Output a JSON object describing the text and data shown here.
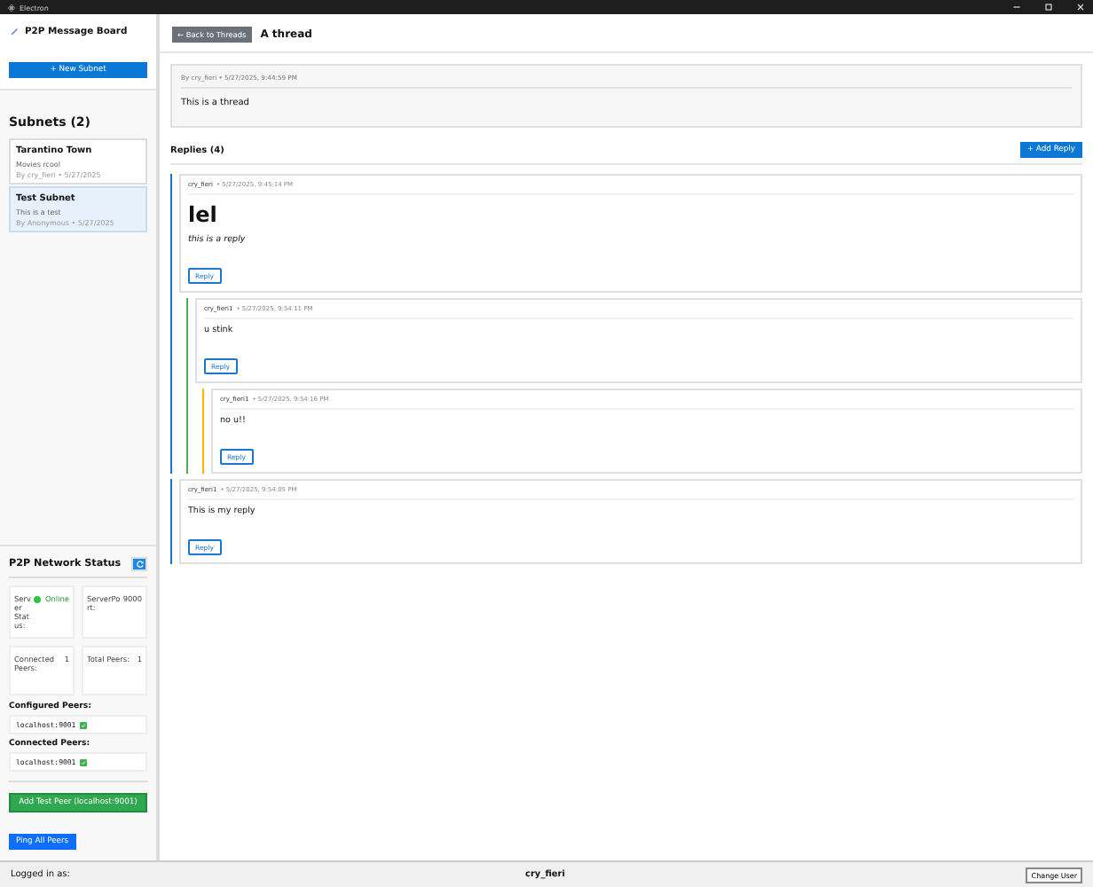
{
  "window": {
    "title": "Electron"
  },
  "sidebar": {
    "app_title": "P2P Message Board",
    "new_subnet_button": "+ New Subnet",
    "subnets_heading": "Subnets (2)",
    "subnets": [
      {
        "name": "Tarantino Town",
        "description": "Movies rcool",
        "meta": "By cry_fieri • 5/27/2025",
        "selected": false
      },
      {
        "name": "Test Subnet",
        "description": "This is a test",
        "meta": "By Anonymous • 5/27/2025",
        "selected": true
      }
    ],
    "network": {
      "heading": "P2P Network Status",
      "stats": [
        {
          "label": "Server Status:",
          "value": "Online",
          "online": true
        },
        {
          "label": "Port:",
          "value": "9000",
          "prefix": "Server"
        },
        {
          "label": "Connected Peers:",
          "value": "1"
        },
        {
          "label": "Total Peers:",
          "value": "1"
        }
      ],
      "configured_heading": "Configured Peers:",
      "configured_peers": [
        {
          "address": "localhost:9001",
          "ok": true
        }
      ],
      "connected_heading": "Connected Peers:",
      "connected_peers": [
        {
          "address": "localhost:9001",
          "ok": true
        }
      ],
      "add_peer_button": "Add Test Peer (localhost:9001)",
      "ping_button": "Ping All Peers"
    }
  },
  "thread": {
    "back_button": "← Back to Threads",
    "title": "A thread",
    "meta": "By cry_fieri • 5/27/2025, 9:44:59 PM",
    "body": "This is a thread"
  },
  "replies_heading": "Replies (4)",
  "add_reply_button": "+ Add Reply",
  "replies": [
    {
      "author": "cry_fieri",
      "time": "• 5/27/2025, 9:45:14 PM",
      "content": [
        {
          "kind": "heading",
          "text": "lel"
        },
        {
          "kind": "italic",
          "text": "this is a reply"
        }
      ],
      "reply_button": "Reply",
      "children": [
        {
          "author": "cry_fieri1",
          "time": "• 5/27/2025, 9:54:11 PM",
          "content": [
            {
              "kind": "paragraph",
              "text": "u stink"
            }
          ],
          "reply_button": "Reply",
          "children": [
            {
              "author": "cry_fieri1",
              "time": "• 5/27/2025, 9:54:16 PM",
              "content": [
                {
                  "kind": "paragraph",
                  "text": "no u!!"
                }
              ],
              "reply_button": "Reply"
            }
          ]
        }
      ]
    },
    {
      "author": "cry_fieri1",
      "time": "• 5/27/2025, 9:54:05 PM",
      "content": [
        {
          "kind": "paragraph",
          "text": "This is my reply"
        }
      ],
      "reply_button": "Reply"
    }
  ],
  "status_bar": {
    "label": "Logged in as:",
    "user": "cry_fieri",
    "change_user_button": "Change User"
  }
}
